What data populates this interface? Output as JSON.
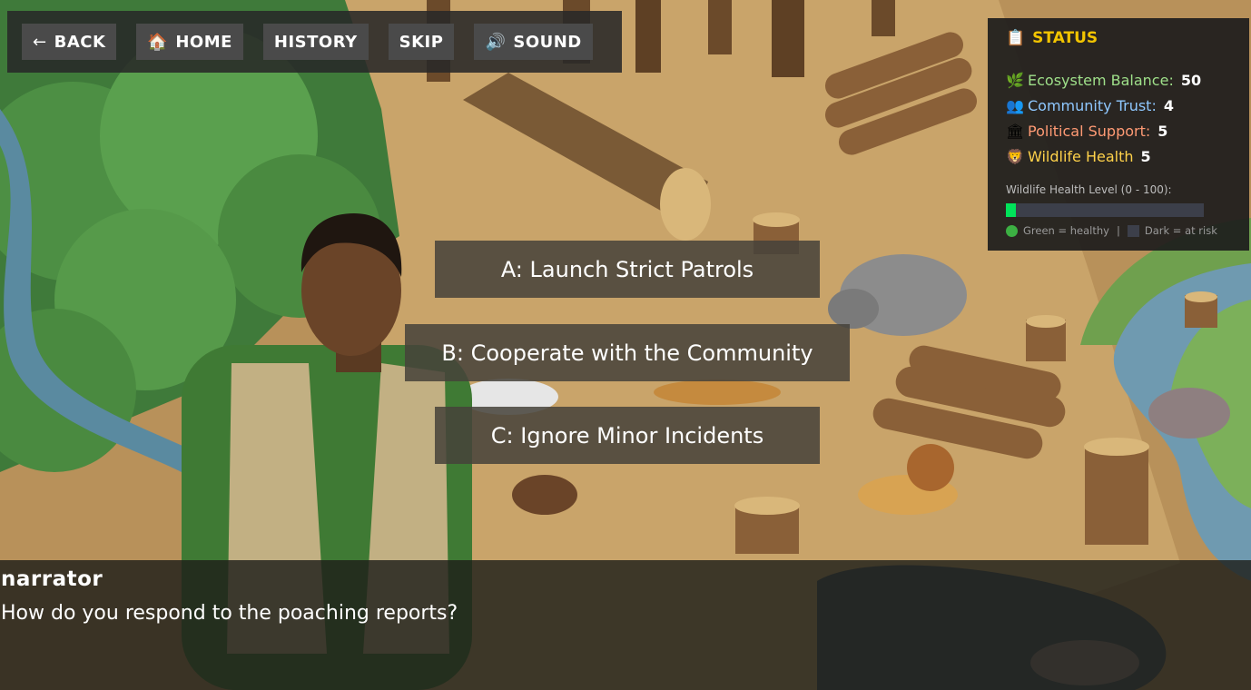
{
  "nav": {
    "back": {
      "icon": "←",
      "label": "BACK"
    },
    "home": {
      "icon": "🏠",
      "label": "HOME"
    },
    "history": {
      "label": "HISTORY"
    },
    "skip": {
      "label": "SKIP"
    },
    "sound": {
      "icon": "🔊",
      "label": "SOUND"
    }
  },
  "status": {
    "title": "STATUS",
    "title_icon": "📋",
    "stats": [
      {
        "icon": "🌿",
        "label": "Ecosystem Balance:",
        "value": "50",
        "color": "#9fe08a"
      },
      {
        "icon": "👥",
        "label": "Community Trust:",
        "value": "4",
        "color": "#8fc8ff"
      },
      {
        "icon": "🏛",
        "label": "Political Support:",
        "value": "5",
        "color": "#ff9a74"
      },
      {
        "icon": "🦁",
        "label": "Wildlife Health",
        "value": "5",
        "color": "#ffd24a"
      }
    ],
    "meter_label": "Wildlife Health Level (0 - 100):",
    "meter_value": 5,
    "meter_max": 100,
    "legend_healthy": "Green = healthy",
    "legend_sep": "|",
    "legend_risk": "Dark = at risk"
  },
  "choices": [
    {
      "label": "A: Launch Strict Patrols"
    },
    {
      "label": "B: Cooperate with the Community"
    },
    {
      "label": "C: Ignore Minor Incidents"
    }
  ],
  "dialogue": {
    "speaker": "narrator",
    "text": "How do you respond to the poaching reports?"
  },
  "colors": {
    "status_title": "#f2c400",
    "meter_fill": "#00e35a",
    "meter_bg": "#3c3f4a"
  }
}
